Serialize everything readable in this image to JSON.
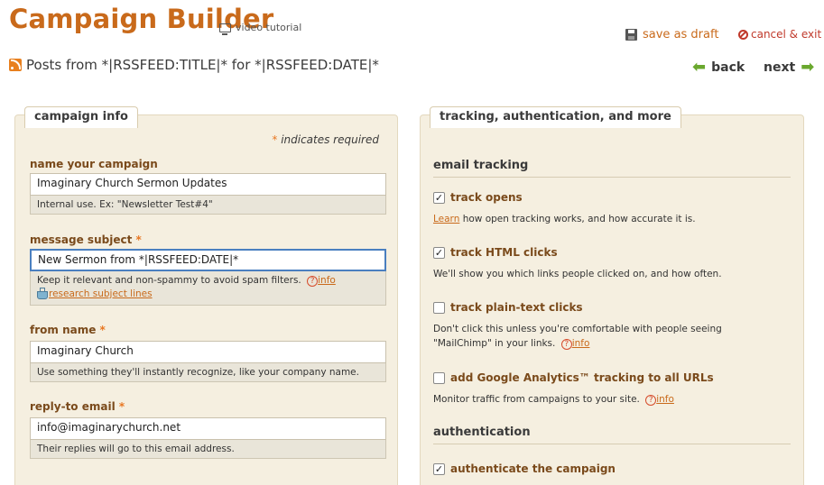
{
  "header": {
    "title": "Campaign Builder",
    "video_tutorial": "video tutorial",
    "save_draft": "save as draft",
    "cancel_exit": "cancel & exit"
  },
  "subheader": {
    "feed_title": "Posts from *|RSSFEED:TITLE|* for *|RSSFEED:DATE|*",
    "back": "back",
    "next": "next"
  },
  "left_panel": {
    "tab": "campaign info",
    "required_star": "*",
    "required_note": "indicates required",
    "name": {
      "label": "name your campaign",
      "value": "Imaginary Church Sermon Updates",
      "help": "Internal use. Ex: \"Newsletter Test#4\""
    },
    "subject": {
      "label": "message subject",
      "star": "*",
      "value": "New Sermon from *|RSSFEED:DATE|*",
      "help": "Keep it relevant and non-spammy to avoid spam filters.",
      "info": "info",
      "research": "research subject lines"
    },
    "from_name": {
      "label": "from name",
      "star": "*",
      "value": "Imaginary Church",
      "help": "Use something they'll instantly recognize, like your company name."
    },
    "reply_to": {
      "label": "reply-to email",
      "star": "*",
      "value": "info@imaginarychurch.net",
      "help": "Their replies will go to this email address."
    }
  },
  "right_panel": {
    "tab": "tracking, authentication, and more",
    "email_tracking": "email tracking",
    "track_opens": {
      "label": "track opens",
      "checked": true,
      "learn": "Learn",
      "desc": "how open tracking works, and how accurate it is."
    },
    "track_html": {
      "label": "track HTML clicks",
      "checked": true,
      "desc": "We'll show you which links people clicked on, and how often."
    },
    "track_plain": {
      "label": "track plain-text clicks",
      "checked": false,
      "desc_1": "Don't click this unless you're comfortable with people seeing",
      "desc_2": "\"MailChimp\" in your links.",
      "info": "info"
    },
    "analytics": {
      "label": "add Google Analytics™ tracking to all URLs",
      "checked": false,
      "desc": "Monitor traffic from campaigns to your site.",
      "info": "info"
    },
    "authentication": "authentication",
    "authenticate": {
      "label": "authenticate the campaign",
      "checked": true
    }
  },
  "colors": {
    "brand": "#c96a1b",
    "panel_bg": "#f5efe0",
    "accent_green": "#6aa82e",
    "focus_blue": "#4a7fc0"
  }
}
